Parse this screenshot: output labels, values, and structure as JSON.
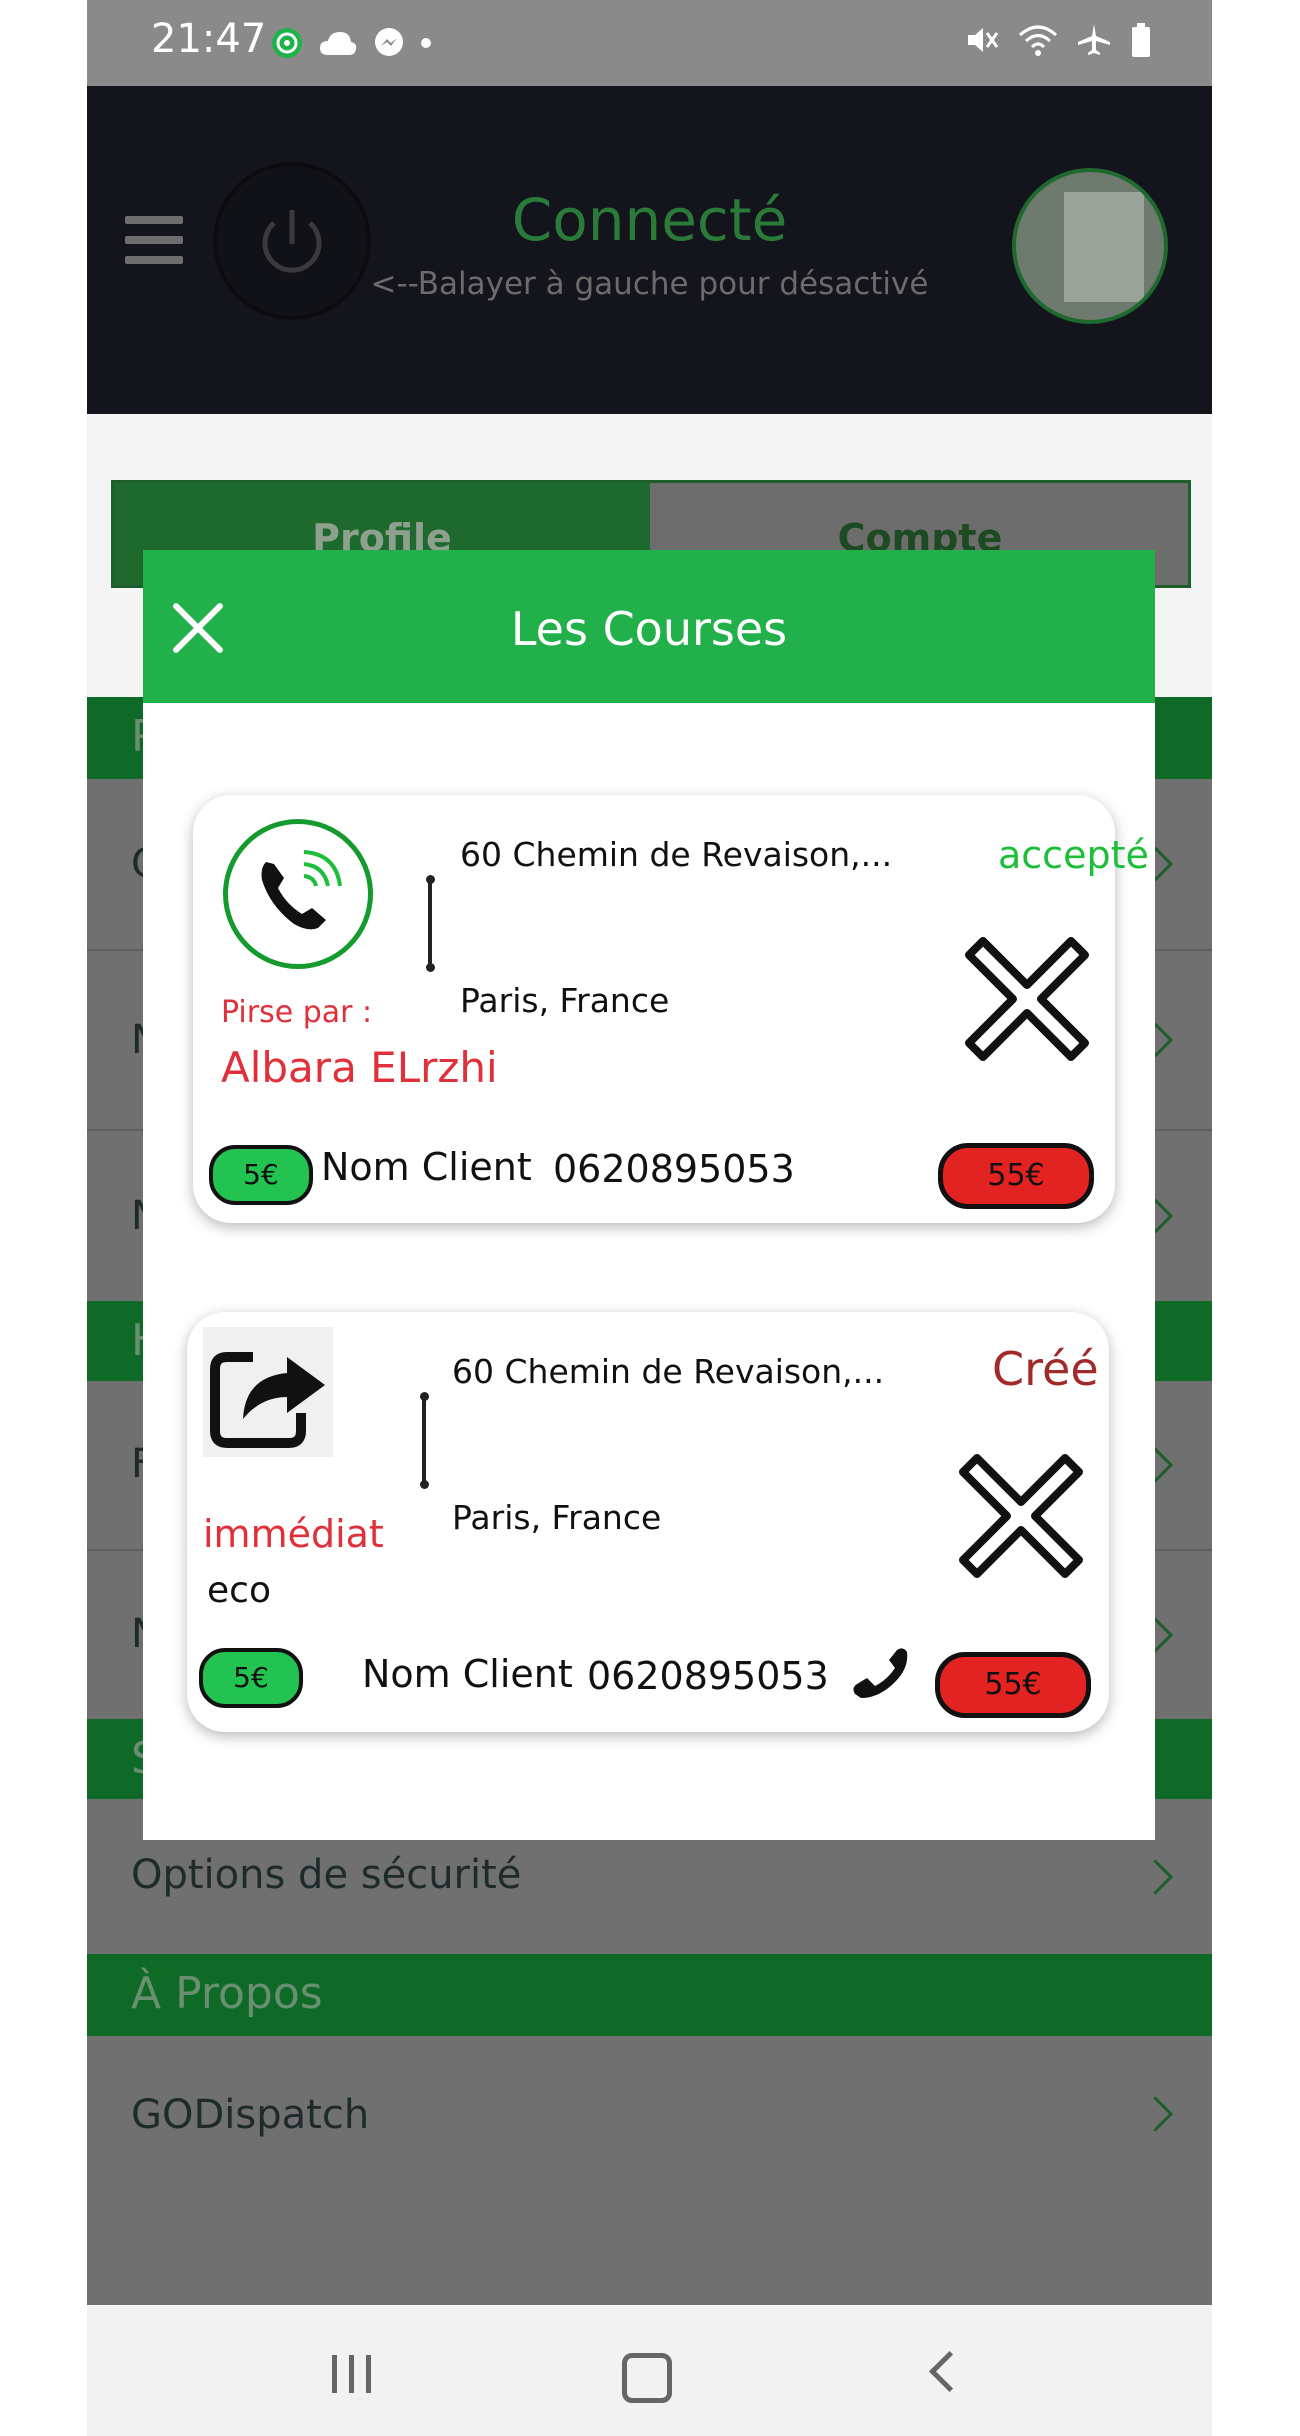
{
  "status_bar": {
    "time": "21:47"
  },
  "header": {
    "title": "Connecté",
    "subtitle": "<--Balayer à gauche pour désactivé"
  },
  "tabs": [
    "Profile",
    "Compte"
  ],
  "background_page": {
    "section_letters": [
      "P",
      "H",
      "S"
    ],
    "row_letters": [
      "C",
      "N",
      "N",
      "F",
      "N"
    ],
    "security_row": "Options de sécurité",
    "about_section": "À Propos",
    "about_row": "GODispatch"
  },
  "modal": {
    "title": "Les Courses",
    "rides": [
      {
        "address_from": "60 Chemin de Revaison,...",
        "address_to": "Paris, France",
        "status": "accepté",
        "taken_by_label": "Pirse par :",
        "taken_by_name": "Albara ELrzhi",
        "tip": "5€",
        "client": "Nom Client",
        "phone": "0620895053",
        "price": "55€"
      },
      {
        "address_from": "60 Chemin de Revaison,...",
        "address_to": "Paris, France",
        "status": "Créé",
        "type": "immédiat",
        "category": "eco",
        "tip": "5€",
        "client": "Nom Client",
        "phone": "0620895053",
        "price": "55€"
      }
    ]
  },
  "colors": {
    "modal_header": "#22b04b",
    "accepted": "#1cbe3a",
    "created": "#a32a2a",
    "alert_red": "#e0303a",
    "price_red": "#e32222",
    "tip_green": "#22c350"
  },
  "icons": [
    "menu-icon",
    "power-icon",
    "avatar",
    "close-icon",
    "phone-call-icon",
    "share-icon",
    "delete-x-icon",
    "phone-icon",
    "chevron-right-icon"
  ]
}
